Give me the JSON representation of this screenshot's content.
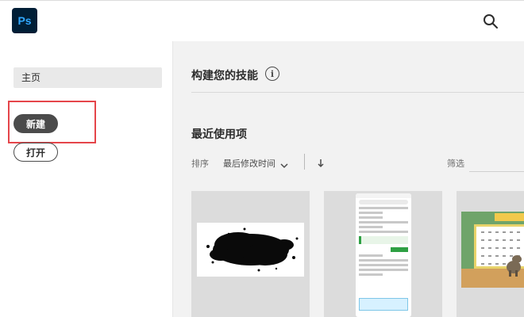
{
  "app": {
    "logo_text": "Ps"
  },
  "topbar": {
    "search_icon": "search-icon"
  },
  "sidebar": {
    "home_label": "主页",
    "new_label": "新建",
    "open_label": "打开"
  },
  "main": {
    "skills_title": "构建您的技能",
    "info_icon_glyph": "i",
    "recent_title": "最近使用项",
    "sort_label": "排序",
    "sort_value": "最后修改时间",
    "filter_label": "筛选",
    "filter_placeholder": ""
  },
  "colors": {
    "ps_bg": "#001e36",
    "ps_text": "#31a8ff",
    "highlight": "#e5454a",
    "new_button": "#4b4b4b"
  }
}
